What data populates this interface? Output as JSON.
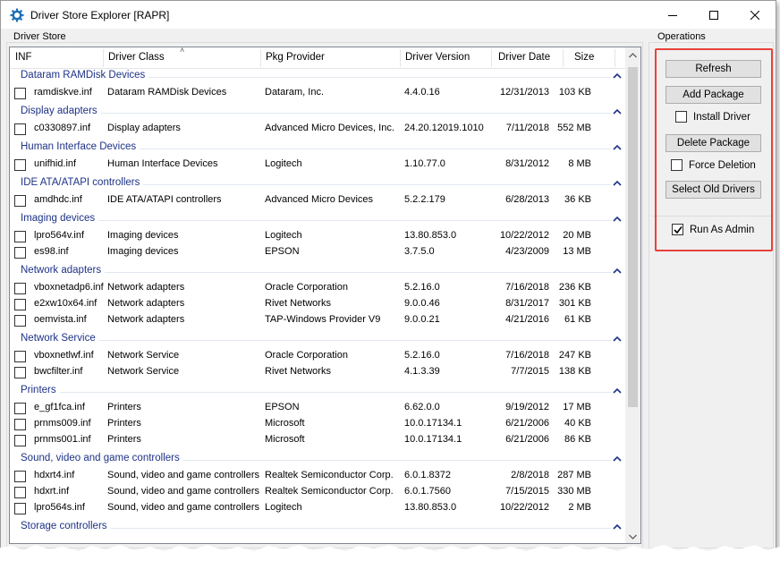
{
  "window": {
    "title": "Driver Store Explorer [RAPR]"
  },
  "driver_store": {
    "label": "Driver Store",
    "columns": [
      "INF",
      "Driver Class",
      "Pkg Provider",
      "Driver Version",
      "Driver Date",
      "Size"
    ],
    "groups": [
      {
        "name": "Dataram RAMDisk Devices",
        "rows": [
          {
            "inf": "ramdiskve.inf",
            "cls": "Dataram RAMDisk Devices",
            "prov": "Dataram, Inc.",
            "ver": "4.4.0.16",
            "date": "12/31/2013",
            "size": "103 KB"
          }
        ]
      },
      {
        "name": "Display adapters",
        "rows": [
          {
            "inf": "c0330897.inf",
            "cls": "Display adapters",
            "prov": "Advanced Micro Devices, Inc.",
            "ver": "24.20.12019.1010",
            "date": "7/11/2018",
            "size": "552 MB"
          }
        ]
      },
      {
        "name": "Human Interface Devices",
        "rows": [
          {
            "inf": "unifhid.inf",
            "cls": "Human Interface Devices",
            "prov": "Logitech",
            "ver": "1.10.77.0",
            "date": "8/31/2012",
            "size": "8 MB"
          }
        ]
      },
      {
        "name": "IDE ATA/ATAPI controllers",
        "rows": [
          {
            "inf": "amdhdc.inf",
            "cls": "IDE ATA/ATAPI controllers",
            "prov": "Advanced Micro Devices",
            "ver": "5.2.2.179",
            "date": "6/28/2013",
            "size": "36 KB"
          }
        ]
      },
      {
        "name": "Imaging devices",
        "rows": [
          {
            "inf": "lpro564v.inf",
            "cls": "Imaging devices",
            "prov": "Logitech",
            "ver": "13.80.853.0",
            "date": "10/22/2012",
            "size": "20 MB"
          },
          {
            "inf": "es98.inf",
            "cls": "Imaging devices",
            "prov": "EPSON",
            "ver": "3.7.5.0",
            "date": "4/23/2009",
            "size": "13 MB"
          }
        ]
      },
      {
        "name": "Network adapters",
        "rows": [
          {
            "inf": "vboxnetadp6.inf",
            "cls": "Network adapters",
            "prov": "Oracle Corporation",
            "ver": "5.2.16.0",
            "date": "7/16/2018",
            "size": "236 KB"
          },
          {
            "inf": "e2xw10x64.inf",
            "cls": "Network adapters",
            "prov": "Rivet Networks",
            "ver": "9.0.0.46",
            "date": "8/31/2017",
            "size": "301 KB"
          },
          {
            "inf": "oemvista.inf",
            "cls": "Network adapters",
            "prov": "TAP-Windows Provider V9",
            "ver": "9.0.0.21",
            "date": "4/21/2016",
            "size": "61 KB"
          }
        ]
      },
      {
        "name": "Network Service",
        "rows": [
          {
            "inf": "vboxnetlwf.inf",
            "cls": "Network Service",
            "prov": "Oracle Corporation",
            "ver": "5.2.16.0",
            "date": "7/16/2018",
            "size": "247 KB"
          },
          {
            "inf": "bwcfilter.inf",
            "cls": "Network Service",
            "prov": "Rivet Networks",
            "ver": "4.1.3.39",
            "date": "7/7/2015",
            "size": "138 KB"
          }
        ]
      },
      {
        "name": "Printers",
        "rows": [
          {
            "inf": "e_gf1fca.inf",
            "cls": "Printers",
            "prov": "EPSON",
            "ver": "6.62.0.0",
            "date": "9/19/2012",
            "size": "17 MB"
          },
          {
            "inf": "prnms009.inf",
            "cls": "Printers",
            "prov": "Microsoft",
            "ver": "10.0.17134.1",
            "date": "6/21/2006",
            "size": "40 KB"
          },
          {
            "inf": "prnms001.inf",
            "cls": "Printers",
            "prov": "Microsoft",
            "ver": "10.0.17134.1",
            "date": "6/21/2006",
            "size": "86 KB"
          }
        ]
      },
      {
        "name": "Sound, video and game controllers",
        "rows": [
          {
            "inf": "hdxrt4.inf",
            "cls": "Sound, video and game controllers",
            "prov": "Realtek Semiconductor Corp.",
            "ver": "6.0.1.8372",
            "date": "2/8/2018",
            "size": "287 MB"
          },
          {
            "inf": "hdxrt.inf",
            "cls": "Sound, video and game controllers",
            "prov": "Realtek Semiconductor Corp.",
            "ver": "6.0.1.7560",
            "date": "7/15/2015",
            "size": "330 MB"
          },
          {
            "inf": "lpro564s.inf",
            "cls": "Sound, video and game controllers",
            "prov": "Logitech",
            "ver": "13.80.853.0",
            "date": "10/22/2012",
            "size": "2 MB"
          }
        ]
      },
      {
        "name": "Storage controllers",
        "rows": []
      }
    ]
  },
  "operations": {
    "label": "Operations",
    "refresh": "Refresh",
    "add_package": "Add Package",
    "install_driver": "Install Driver",
    "install_driver_checked": false,
    "delete_package": "Delete Package",
    "force_deletion": "Force Deletion",
    "force_deletion_checked": false,
    "select_old_drivers": "Select Old Drivers",
    "run_as_admin": "Run As Admin",
    "run_as_admin_checked": true
  },
  "colors": {
    "group_header": "#1e3287",
    "highlight_border": "#e8413c"
  }
}
